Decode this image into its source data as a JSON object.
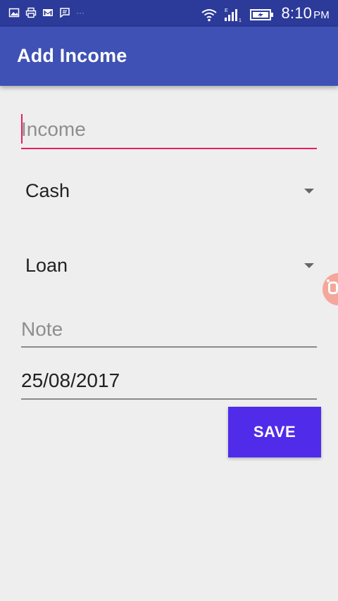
{
  "status_bar": {
    "time": "8:10",
    "ampm": "PM",
    "left_icons": [
      "gallery-icon",
      "printer-icon",
      "gmail-icon",
      "message-icon"
    ],
    "more": "···",
    "right_icons": [
      "wifi-icon",
      "signal-icon",
      "battery-icon"
    ]
  },
  "app_bar": {
    "title": "Add Income"
  },
  "form": {
    "income_placeholder": "Income",
    "account_selected": "Cash",
    "category_selected": "Loan",
    "note_placeholder": "Note",
    "date_value": "25/08/2017",
    "save_label": "SAVE"
  },
  "colors": {
    "status_bar": "#2c3a9a",
    "app_bar": "#3f51b5",
    "accent": "#e91e63",
    "save_button": "#512bea",
    "background": "#eeeeee"
  }
}
